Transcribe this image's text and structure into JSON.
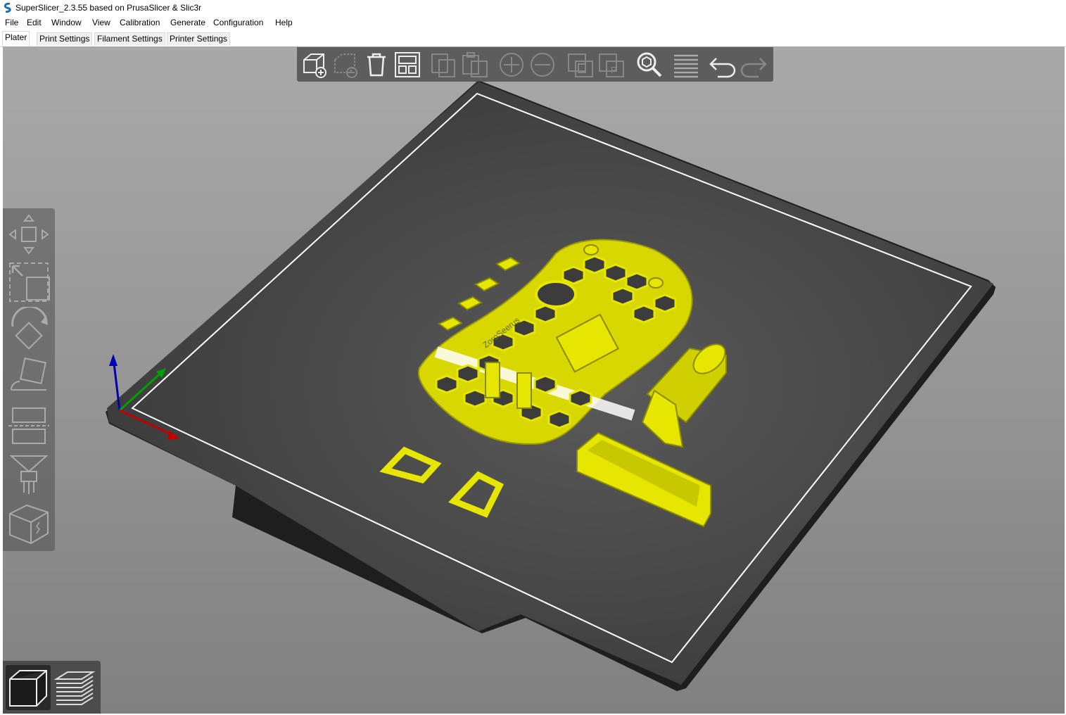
{
  "window": {
    "title": "SuperSlicer_2.3.55 based on PrusaSlicer & Slic3r"
  },
  "menu": [
    "File",
    "Edit",
    "Window",
    "View",
    "Calibration",
    "Generate",
    "Configuration",
    "Help"
  ],
  "tabs": [
    {
      "label": "Plater",
      "active": true
    },
    {
      "label": "Print Settings"
    },
    {
      "label": "Filament Settings"
    },
    {
      "label": "Printer Settings"
    }
  ],
  "colors": {
    "model": "#e6e600",
    "bed": "#3c3c3c",
    "bed_border": "#ffffff",
    "toolbar_bg": "#505050",
    "axis_x": "#c00000",
    "axis_y": "#00a000",
    "axis_z": "#0000b0"
  },
  "toolbar": {
    "top": [
      "add-icon",
      "delete-icon",
      "delete-all-icon",
      "arrange-icon",
      "copy-icon",
      "paste-icon",
      "add-instance-icon",
      "remove-instance-icon",
      "split-objects-icon",
      "split-parts-icon",
      "search-icon",
      "layers-editing-icon",
      "undo-icon",
      "redo-icon"
    ],
    "left": [
      "move-icon",
      "scale-icon",
      "rotate-icon",
      "place-on-face-icon",
      "cut-icon",
      "paint-supports-icon",
      "paint-seam-icon"
    ],
    "views": [
      "3d-view-icon",
      "preview-icon"
    ]
  },
  "model_label": "ZoroSeerus"
}
